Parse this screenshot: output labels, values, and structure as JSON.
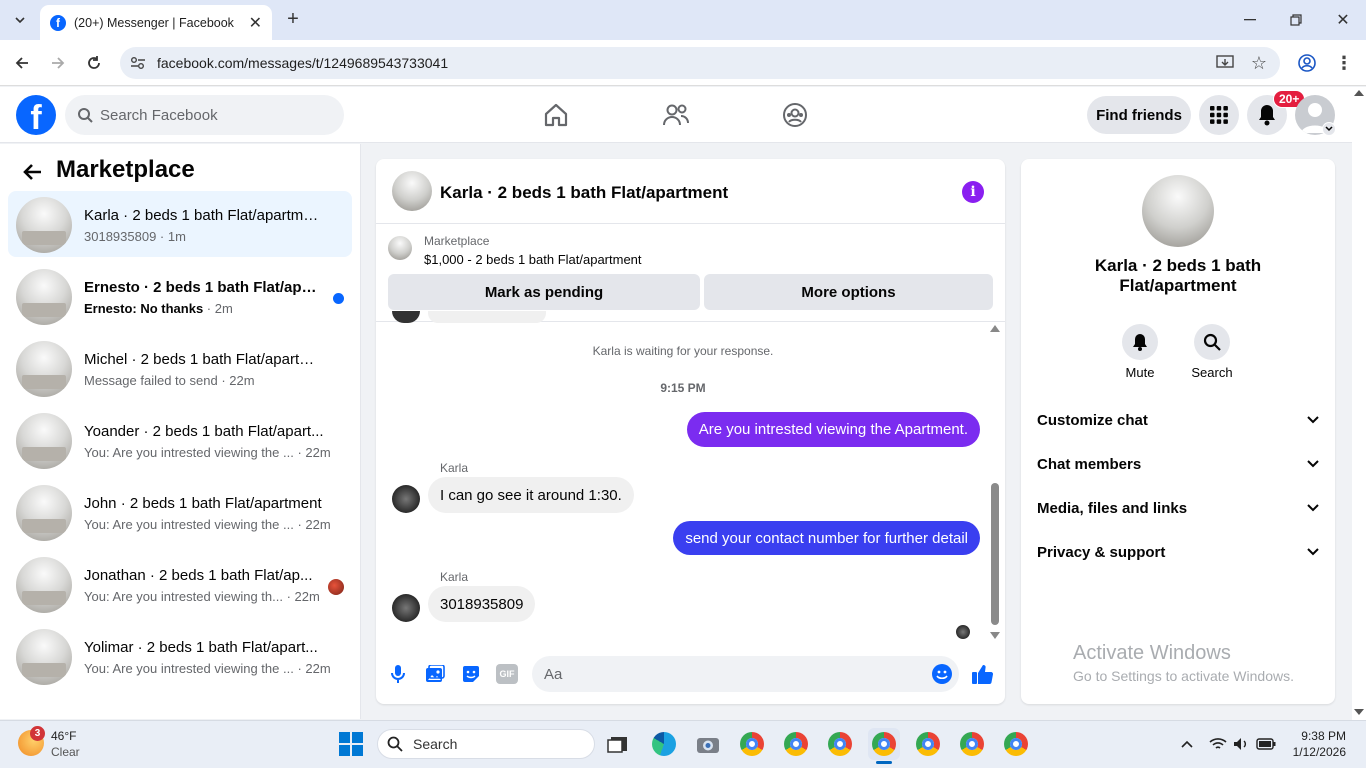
{
  "browser": {
    "tab_title": "(20+) Messenger | Facebook",
    "url": "facebook.com/messages/t/1249689543733041"
  },
  "fb": {
    "search_placeholder": "Search Facebook",
    "find_friends": "Find friends",
    "notif_badge": "20+"
  },
  "left": {
    "title": "Marketplace",
    "conversations": [
      {
        "title": "Karla · 2 beds 1 bath Flat/apartment",
        "sub": "3018935809",
        "time": "1m"
      },
      {
        "title": "Ernesto · 2 beds 1 bath Flat/apart...",
        "sub": "Ernesto: No thanks",
        "time": "2m"
      },
      {
        "title": "Michel · 2 beds 1 bath Flat/apartm...",
        "sub": "Message failed to send",
        "time": "22m"
      },
      {
        "title": "Yoander · 2 beds 1 bath Flat/apart...",
        "sub": "You: Are you intrested viewing the ...",
        "time": "22m"
      },
      {
        "title": "John · 2 beds 1 bath Flat/apartment",
        "sub": "You: Are you intrested viewing the ...",
        "time": "22m"
      },
      {
        "title": "Jonathan · 2 beds 1 bath Flat/ap...",
        "sub": "You: Are you intrested viewing th...",
        "time": "22m"
      },
      {
        "title": "Yolimar · 2 beds 1 bath Flat/apart...",
        "sub": "You: Are you intrested viewing the ...",
        "time": "22m"
      }
    ]
  },
  "chat": {
    "title": "Karla · 2 beds 1 bath Flat/apartment",
    "listing_label": "Marketplace",
    "listing_text": "$1,000 - 2 beds 1 bath Flat/apartment",
    "mark_pending": "Mark as pending",
    "more_options": "More options",
    "waiting": "Karla is waiting for your response.",
    "time_sep": "9:15 PM",
    "messages": [
      {
        "from": "me",
        "text": "Are you intrested viewing the Apartment."
      },
      {
        "from": "Karla",
        "sender": "Karla",
        "text": "I can go see it around 1:30."
      },
      {
        "from": "me",
        "text": "send your contact number for further detail"
      },
      {
        "from": "Karla",
        "sender": "Karla",
        "text": "3018935809"
      }
    ],
    "composer_placeholder": "Aa"
  },
  "right": {
    "name": "Karla · 2 beds 1 bath Flat/apartment",
    "mute": "Mute",
    "search": "Search",
    "sections": [
      "Customize chat",
      "Chat members",
      "Media, files and links",
      "Privacy & support"
    ],
    "watermark_title": "Activate Windows",
    "watermark_sub": "Go to Settings to activate Windows."
  },
  "taskbar": {
    "weather_temp": "46°F",
    "weather_desc": "Clear",
    "weather_badge": "3",
    "search": "Search",
    "time": "9:38 PM",
    "date": "1/12/2026"
  },
  "colors": {
    "fb_blue": "#0866ff",
    "outgoing": "#7b2cf0",
    "outgoing2": "#3a3ff0",
    "unread_dot": "#0866ff",
    "badge_red": "#e41e3f"
  }
}
